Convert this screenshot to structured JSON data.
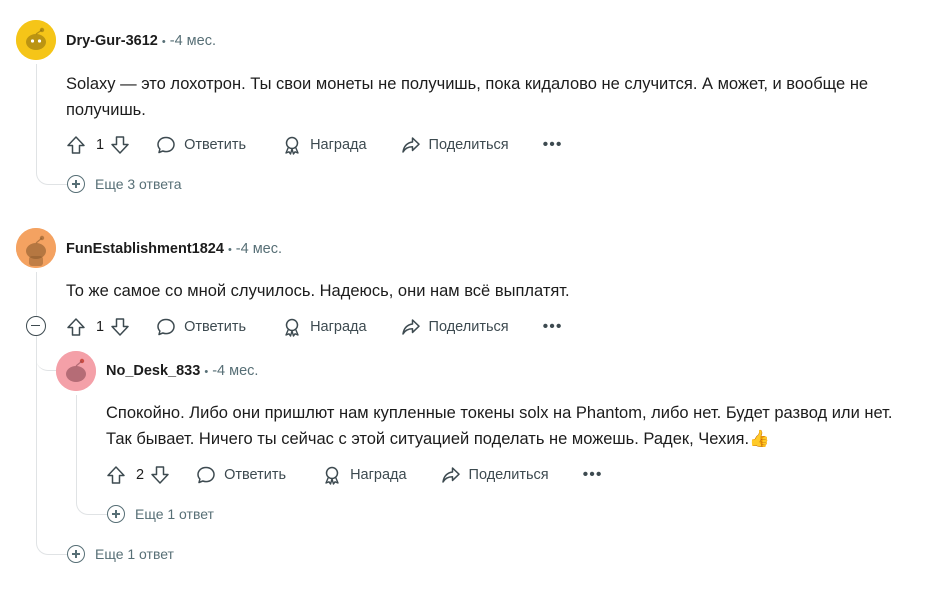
{
  "comments": [
    {
      "author": "Dry-Gur-3612",
      "separator": "•",
      "time": "-4 мес.",
      "text": "Solaxy — это лохотрон. Ты свои монеты не получишь, пока кидалово не случится. А может, и вообще не получишь.",
      "votes": "1",
      "reply_label": "Ответить",
      "award_label": "Награда",
      "share_label": "Поделиться",
      "more_label": "•••",
      "more_replies": "Еще 3 ответа",
      "avatar_color": "#f5c518"
    },
    {
      "author": "FunEstablishment1824",
      "separator": "•",
      "time": "-4 мес.",
      "text": "То же самое со мной случилось. Надеюсь, они нам всё выплатят.",
      "votes": "1",
      "reply_label": "Ответить",
      "award_label": "Награда",
      "share_label": "Поделиться",
      "more_label": "•••",
      "more_replies": "Еще 1 ответ",
      "avatar_color": "#f4a261",
      "reply": {
        "author": "No_Desk_833",
        "separator": "•",
        "time": "-4 мес.",
        "text": "Спокойно. Либо они пришлют нам купленные токены solx на Phantom, либо нет. Будет развод или нет. Так бывает. Ничего ты сейчас с этой ситуацией поделать не можешь. Радек, Чехия.👍",
        "votes": "2",
        "reply_label": "Ответить",
        "award_label": "Награда",
        "share_label": "Поделиться",
        "more_label": "•••",
        "more_replies": "Еще 1 ответ",
        "avatar_color": "#f4a0a8"
      }
    }
  ],
  "colors": {
    "meta": "#576f76",
    "thread_line": "#e0e3e5",
    "text": "#1c1c1c"
  }
}
